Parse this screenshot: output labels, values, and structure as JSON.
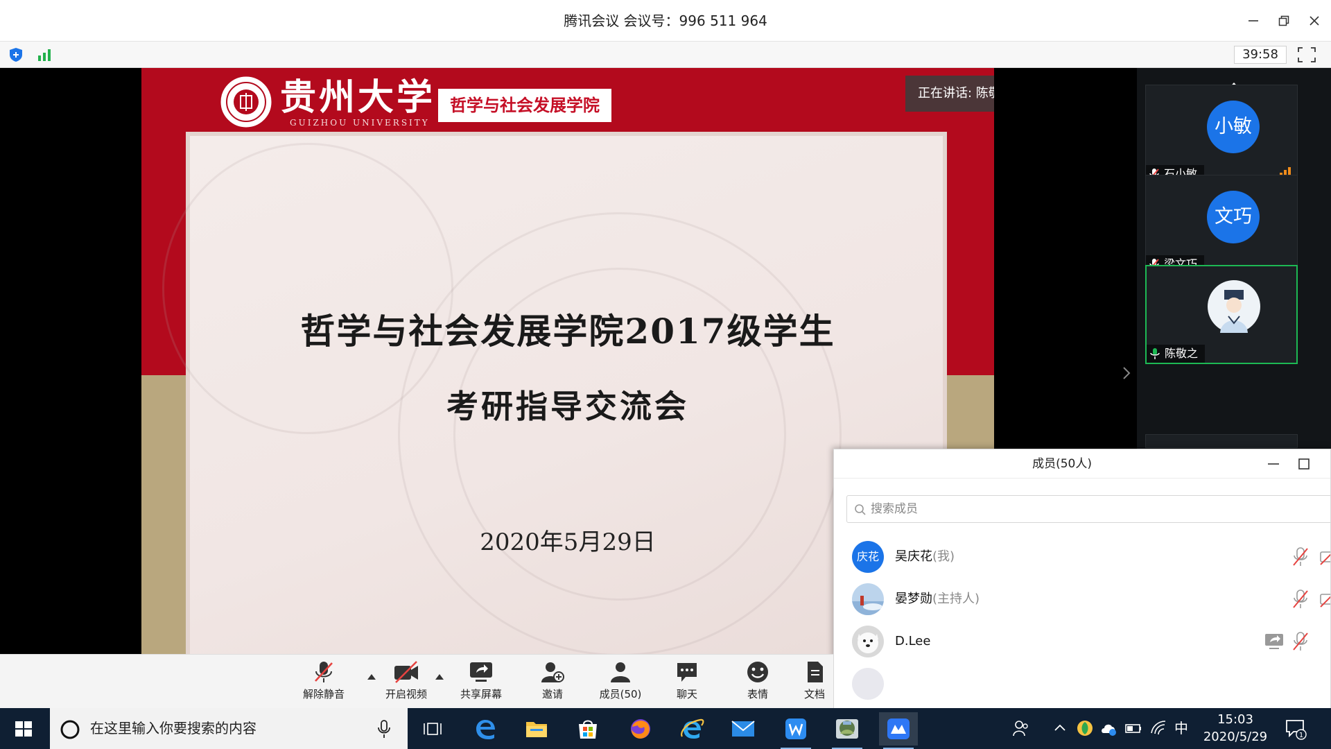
{
  "window": {
    "title": "腾讯会议 会议号：996 511 964"
  },
  "infobar": {
    "timer": "39:58"
  },
  "slide": {
    "university_name": "贵州大学",
    "university_en": "GUIZHOU UNIVERSITY",
    "college_tag": "哲学与社会发展学院",
    "speaking_label": "正在讲话: 陈敬之;",
    "title_line1": "哲学与社会发展学院2017级学生",
    "title_line2": "考研指导交流会",
    "date": "2020年5月29日"
  },
  "participants_tiles": [
    {
      "avatar_text": "小敏",
      "name": "石小敏",
      "mic": "muted",
      "signal": "orange"
    },
    {
      "avatar_text": "文巧",
      "name": "梁文巧",
      "mic": "muted"
    },
    {
      "avatar_text": "",
      "name": "陈敬之",
      "mic": "speaking",
      "active": true
    }
  ],
  "members_panel": {
    "title": "成员(50人)",
    "search_placeholder": "搜索成员",
    "members": [
      {
        "avatar_text": "庆花",
        "name": "吴庆花",
        "role": "(我)",
        "mic": "muted",
        "camera": "off"
      },
      {
        "avatar_text": "",
        "name": "晏梦勋",
        "role": "(主持人)",
        "mic": "muted",
        "camera": "off"
      },
      {
        "avatar_text": "",
        "name": "D.Lee",
        "role": "",
        "mic": "muted",
        "sharing": true
      }
    ]
  },
  "toolbar": {
    "unmute": "解除静音",
    "start_video": "开启视频",
    "share_screen": "共享屏幕",
    "invite": "邀请",
    "members": "成员(50)",
    "chat": "聊天",
    "reactions": "表情",
    "docs": "文档"
  },
  "taskbar": {
    "search_placeholder": "在这里输入你要搜索的内容",
    "ime": "中",
    "time": "15:03",
    "date": "2020/5/29",
    "notification_count": "1"
  },
  "colors": {
    "slide_red": "#b30a1d",
    "slide_gold": "#b9a77e",
    "tencent_blue": "#1b74e8",
    "active_green": "#1db954",
    "mute_red": "#e64340"
  }
}
